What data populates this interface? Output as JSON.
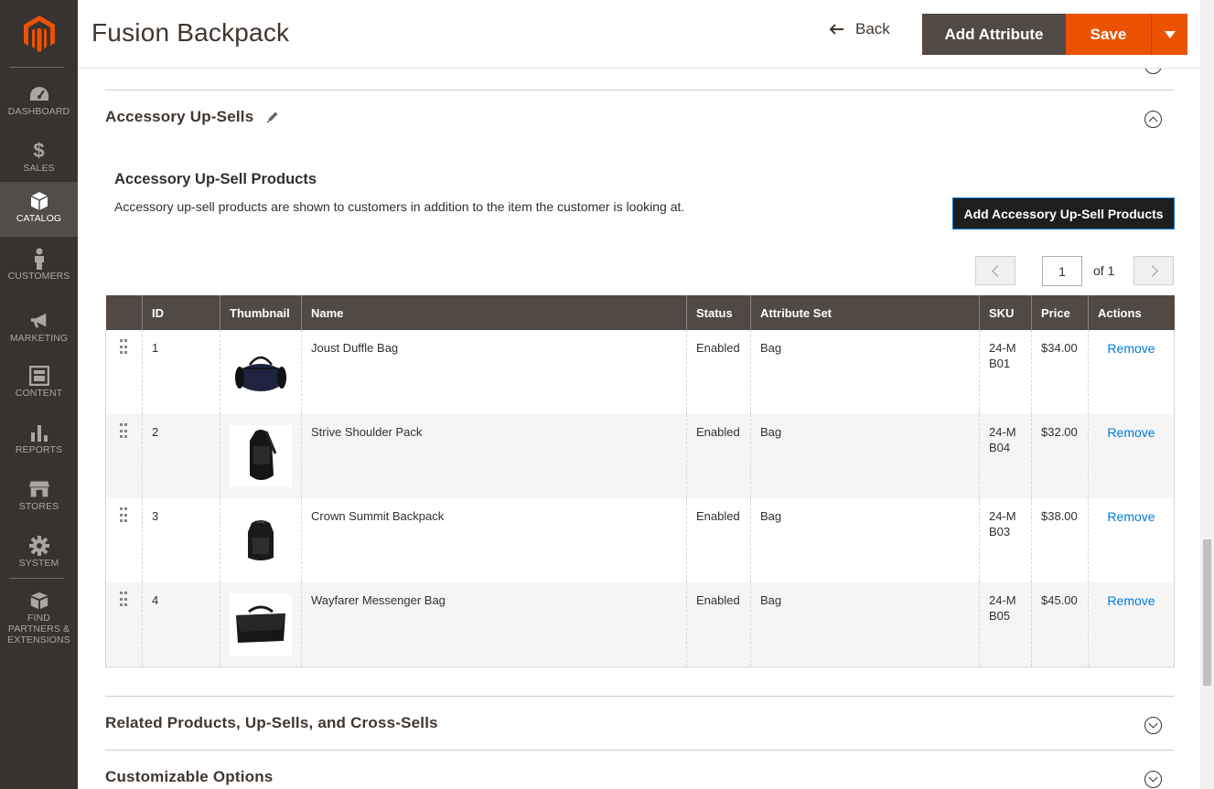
{
  "sidebar": {
    "items": [
      {
        "label": "DASHBOARD",
        "icon": "dashboard-icon"
      },
      {
        "label": "SALES",
        "icon": "dollar-icon"
      },
      {
        "label": "CATALOG",
        "icon": "cube-icon",
        "active": true
      },
      {
        "label": "CUSTOMERS",
        "icon": "person-icon"
      },
      {
        "label": "MARKETING",
        "icon": "megaphone-icon"
      },
      {
        "label": "CONTENT",
        "icon": "layout-icon"
      },
      {
        "label": "REPORTS",
        "icon": "bar-chart-icon"
      },
      {
        "label": "STORES",
        "icon": "storefront-icon"
      },
      {
        "label": "SYSTEM",
        "icon": "gear-icon"
      },
      {
        "label": "FIND PARTNERS & EXTENSIONS",
        "icon": "boxes-icon"
      }
    ]
  },
  "header": {
    "title": "Fusion Backpack",
    "back_label": "Back",
    "add_attribute_label": "Add Attribute",
    "save_label": "Save"
  },
  "section": {
    "title": "Accessory Up-Sells",
    "subtitle": "Accessory Up-Sell Products",
    "description": "Accessory up-sell products are shown to customers in addition to the item the customer is looking at.",
    "add_button_label": "Add Accessory Up-Sell Products"
  },
  "pager": {
    "current": "1",
    "of_label": "of 1"
  },
  "table": {
    "columns": [
      "",
      "ID",
      "Thumbnail",
      "Name",
      "Status",
      "Attribute Set",
      "SKU",
      "Price",
      "Actions"
    ],
    "rows": [
      {
        "id": "1",
        "name": "Joust Duffle Bag",
        "status": "Enabled",
        "attribute_set": "Bag",
        "sku": "24-MB01",
        "price": "$34.00",
        "action": "Remove",
        "thumb": "duffle-bag"
      },
      {
        "id": "2",
        "name": "Strive Shoulder Pack",
        "status": "Enabled",
        "attribute_set": "Bag",
        "sku": "24-MB04",
        "price": "$32.00",
        "action": "Remove",
        "thumb": "shoulder-pack"
      },
      {
        "id": "3",
        "name": "Crown Summit Backpack",
        "status": "Enabled",
        "attribute_set": "Bag",
        "sku": "24-MB03",
        "price": "$38.00",
        "action": "Remove",
        "thumb": "backpack"
      },
      {
        "id": "4",
        "name": "Wayfarer Messenger Bag",
        "status": "Enabled",
        "attribute_set": "Bag",
        "sku": "24-MB05",
        "price": "$45.00",
        "action": "Remove",
        "thumb": "messenger-bag"
      }
    ]
  },
  "sections_below": [
    {
      "title": "Related Products, Up-Sells, and Cross-Sells"
    },
    {
      "title": "Customizable Options"
    }
  ],
  "colors": {
    "accent": "#eb5202",
    "sidebar_bg": "#373330",
    "table_header": "#514943",
    "link": "#007bdb"
  }
}
